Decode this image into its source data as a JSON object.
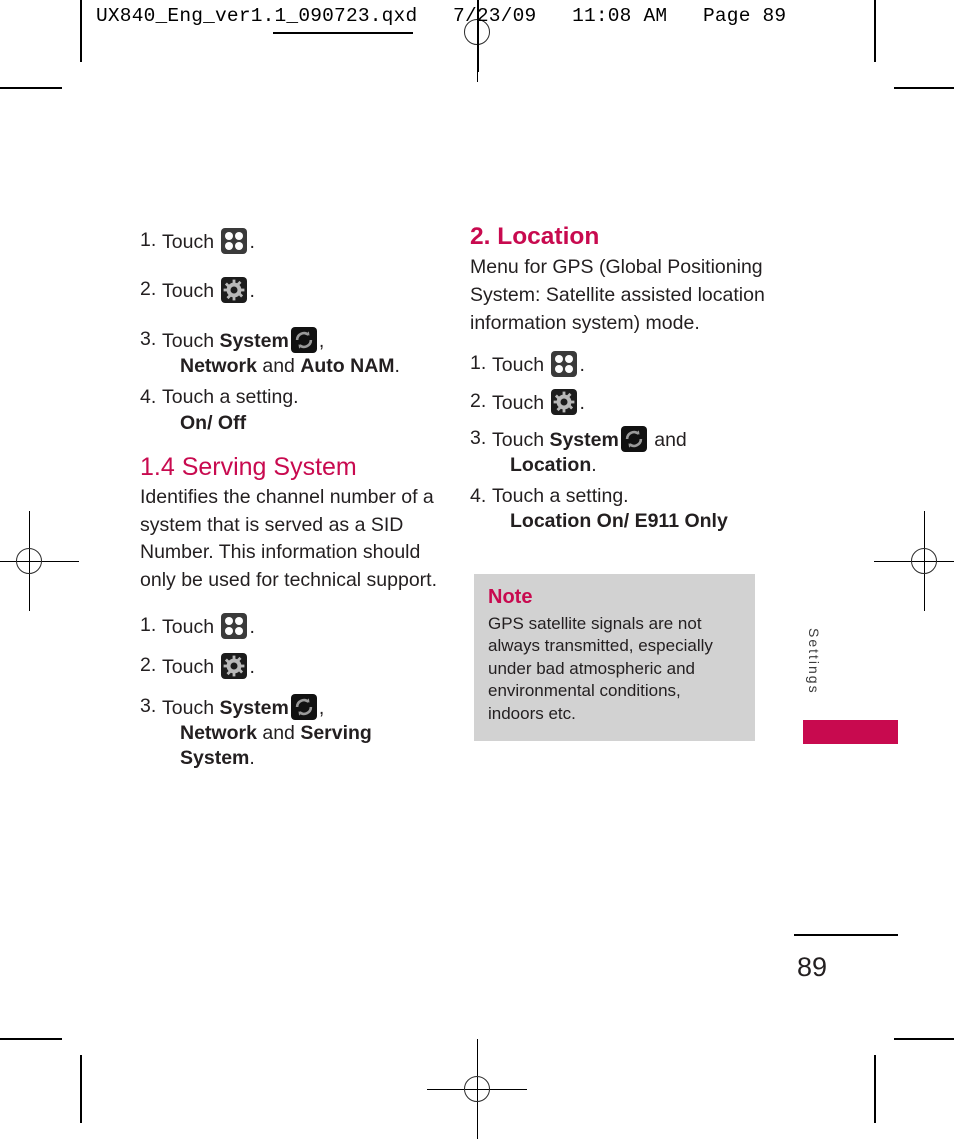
{
  "slug": "UX840_Eng_ver1.1_090723.qxd   7/23/09   11:08 AM   Page 89",
  "colors": {
    "accent": "#c80a4f",
    "text": "#231f20",
    "note_background": "#d2d2d2"
  },
  "left_column": {
    "steps_top": [
      {
        "num": "1.",
        "pre": "Touch ",
        "icon": "grid-icon",
        "post": "."
      },
      {
        "num": "2.",
        "pre": "Touch ",
        "icon": "gear-icon",
        "post": "."
      },
      {
        "num": "3.",
        "pre": "Touch ",
        "bold": "System",
        "icon": "system-icon",
        "post": ",",
        "sub_bold_a": "Network",
        "sub_mid": " and ",
        "sub_bold_b": "Auto NAM",
        "sub_end": "."
      },
      {
        "num": "4.",
        "pre": "Touch a setting.",
        "sub_bold_a": "On/ Off"
      }
    ],
    "section": {
      "heading": "1.4 Serving System",
      "body": "Identifies the channel number of a system that is served as a SID Number. This information should only be used for technical support."
    },
    "steps_bottom": [
      {
        "num": "1.",
        "pre": "Touch ",
        "icon": "grid-icon",
        "post": "."
      },
      {
        "num": "2.",
        "pre": "Touch ",
        "icon": "gear-icon",
        "post": "."
      },
      {
        "num": "3.",
        "pre": "Touch ",
        "bold": "System",
        "icon": "system-icon",
        "post": ",",
        "sub_bold_a": "Network",
        "sub_mid": " and ",
        "sub_bold_b": "Serving System",
        "sub_end": "."
      }
    ]
  },
  "right_column": {
    "section": {
      "heading": "2. Location",
      "body": "Menu for GPS (Global Positioning System: Satellite assisted location information system) mode."
    },
    "steps": [
      {
        "num": "1.",
        "pre": "Touch ",
        "icon": "grid-icon",
        "post": "."
      },
      {
        "num": "2.",
        "pre": "Touch ",
        "icon": "gear-icon",
        "post": "."
      },
      {
        "num": "3.",
        "pre": "Touch ",
        "bold": "System",
        "icon": "system-icon",
        "post": " and",
        "sub_bold_a": "Location",
        "sub_end": "."
      },
      {
        "num": "4.",
        "pre": "Touch a setting.",
        "sub_bold_a": "Location On/ E911  Only"
      }
    ],
    "note": {
      "title": "Note",
      "body": "GPS satellite signals are not always transmitted, especially under bad atmospheric and environmental conditions, indoors etc."
    }
  },
  "side_tab": {
    "label": "Settings"
  },
  "folio": {
    "page_number": "89"
  }
}
